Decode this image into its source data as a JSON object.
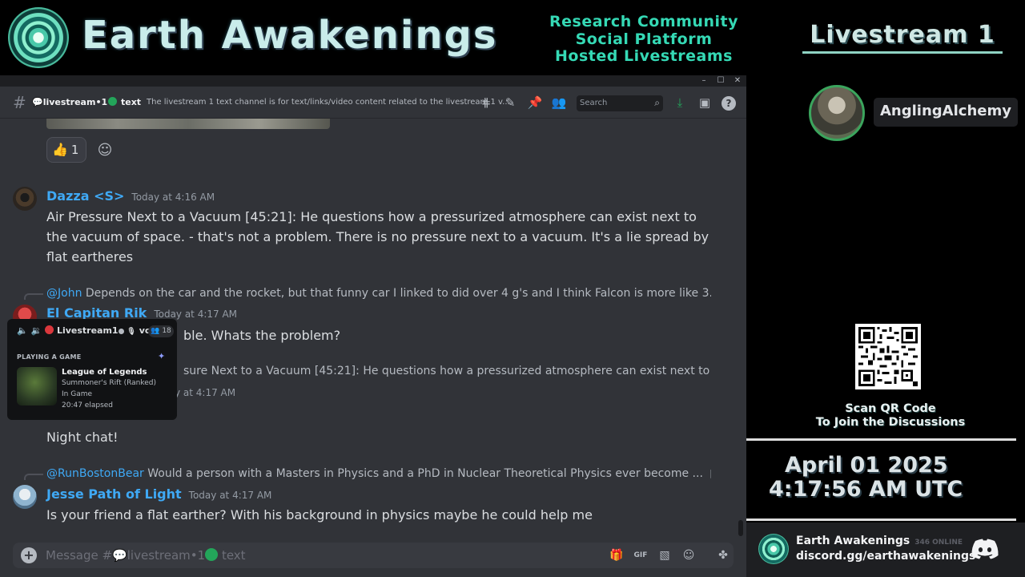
{
  "banner": {
    "title": "Earth Awakenings",
    "taglines": [
      "Research Community",
      "Social Platform",
      "Hosted Livestreams"
    ]
  },
  "window": {
    "controls": [
      "–",
      "☐",
      "✕"
    ]
  },
  "channel": {
    "name_prefix": "💬livestream•1",
    "name_suffix": "text",
    "topic": "The livestream 1 text channel is for text/links/video content related to the livestream 1 v...",
    "search_placeholder": "Search",
    "header_icons": [
      "threads-icon",
      "mute-icon",
      "pin-icon",
      "members-icon",
      "download-icon",
      "inbox-icon",
      "help-icon"
    ]
  },
  "messages": {
    "reaction_emoji": "👍",
    "reaction_count": "1",
    "m1": {
      "author": "Dazza <S>",
      "time": "Today at 4:16 AM",
      "text": "Air Pressure Next to a Vacuum [45:21]: He questions how a pressurized atmosphere can exist next to the vacuum of space. - that's not a problem. There is no pressure next to a vacuum. It's a lie spread by flat eartheres"
    },
    "m2": {
      "reply_to": "@John",
      "reply_text": "Depends on the car and the rocket, but that funny car I linked to did over 4 g's and I think Falcon is more like 3.",
      "author": "El Capitan Rik",
      "time": "Today at 4:17 AM",
      "text_visible": "ble. Whats the problem?"
    },
    "m3": {
      "reply_text_visible": "sure Next to a Vacuum [45:21]: He questions how a pressurized atmosphere can exist next to the ...",
      "time_visible": "y at 4:17 AM",
      "text": "Night chat!"
    },
    "m4": {
      "reply_to": "@RunBostonBear",
      "reply_text": "Would a person with a Masters in Physics and a PhD in Nuclear Theoretical Physics ever become ...",
      "author": "Jesse Path of Light",
      "time": "Today at 4:17 AM",
      "text": "Is your friend a flat earther? With his background in physics maybe he could help me"
    }
  },
  "composer": {
    "placeholder_prefix": "Message #💬livestream•1",
    "placeholder_suffix": "text"
  },
  "voice_popup": {
    "channel": "Livestream1",
    "suffix": "vc",
    "count": "18",
    "label": "PLAYING A GAME",
    "game": "League of Legends",
    "detail1": "Summoner's Rift (Ranked)",
    "detail2": "In Game",
    "detail3": "20:47 elapsed"
  },
  "right_panel": {
    "title": "Livestream 1",
    "host_name": "AnglingAlchemy",
    "qr_caption_1": "Scan QR Code",
    "qr_caption_2": "To Join the Discussions",
    "date_line": "April 01 2025",
    "time_line": "4:17:56 AM UTC",
    "invite_name": "Earth Awakenings",
    "invite_online": "346 ONLINE",
    "invite_link": "discord.gg/earthawakenings"
  },
  "colors": {
    "accent_teal": "#35d9b5",
    "username_blue": "#3fa9f5",
    "online_green": "#23a55a",
    "discord_bg": "#313338"
  }
}
